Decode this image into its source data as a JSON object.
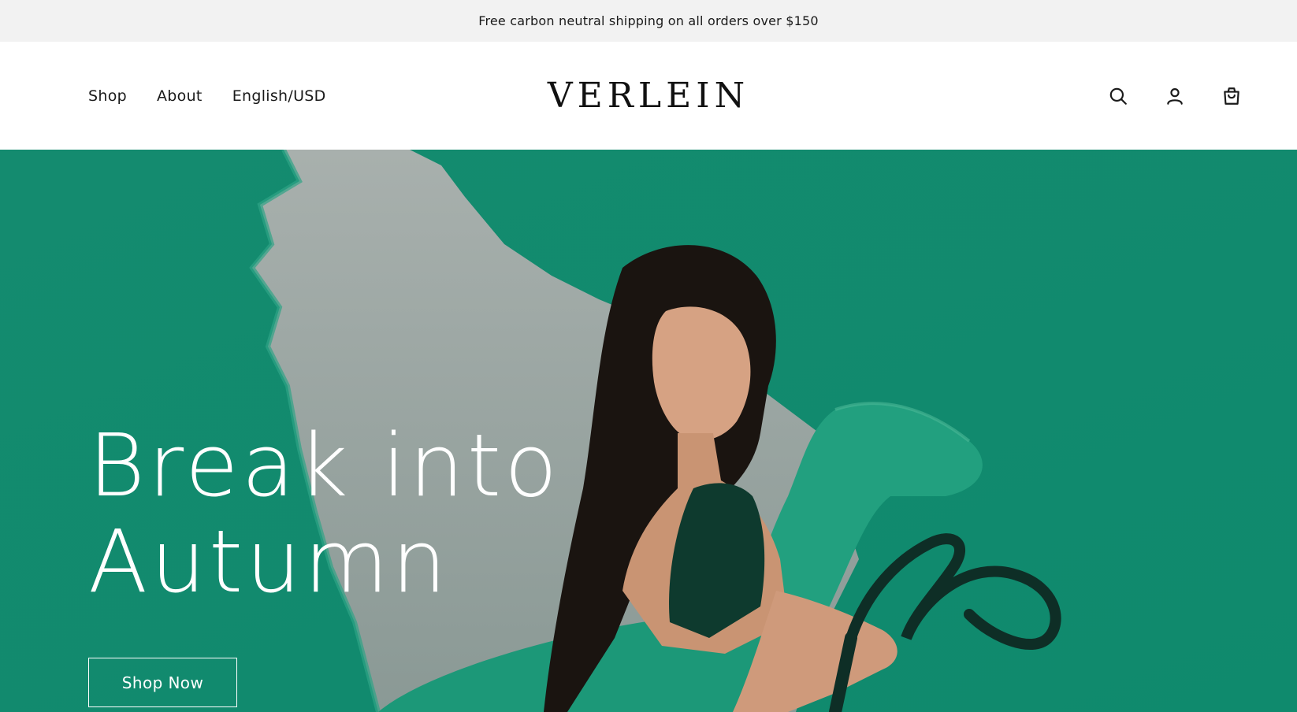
{
  "announcement": {
    "text": "Free carbon neutral shipping on all orders over $150"
  },
  "header": {
    "nav": [
      {
        "label": "Shop"
      },
      {
        "label": "About"
      },
      {
        "label": "English/USD"
      }
    ],
    "logo": "VERLEIN",
    "icons": [
      "search-icon",
      "account-icon",
      "cart-icon"
    ]
  },
  "hero": {
    "title_line1": "Break into",
    "title_line2": "Autumn",
    "cta_label": "Shop Now"
  },
  "colors": {
    "announcement_bg": "#f2f2f2",
    "hero_green": "#138b6f",
    "text_dark": "#1a1a1a",
    "hero_text": "#ffffff"
  }
}
